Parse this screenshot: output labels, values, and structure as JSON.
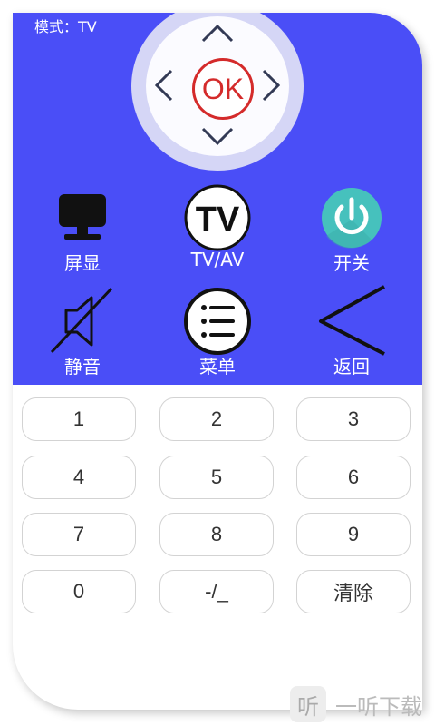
{
  "mode": {
    "label": "模式：TV"
  },
  "dpad": {
    "ok_label": "OK"
  },
  "functions": [
    {
      "label": "屏显",
      "icon": "monitor-icon"
    },
    {
      "label": "TV/AV",
      "icon": "tv-av-icon"
    },
    {
      "label": "开关",
      "icon": "power-icon"
    },
    {
      "label": "静音",
      "icon": "mute-icon"
    },
    {
      "label": "菜单",
      "icon": "menu-icon"
    },
    {
      "label": "返回",
      "icon": "back-icon"
    }
  ],
  "tv_icon_text": "TV",
  "keys": [
    "1",
    "2",
    "3",
    "4",
    "5",
    "6",
    "7",
    "8",
    "9",
    "0",
    "-/_",
    "清除"
  ],
  "watermark": {
    "logo": "听",
    "text": "一听下载"
  },
  "colors": {
    "panel": "#4a4ef7",
    "ok": "#d42b2b",
    "power": "#46c1bd"
  }
}
